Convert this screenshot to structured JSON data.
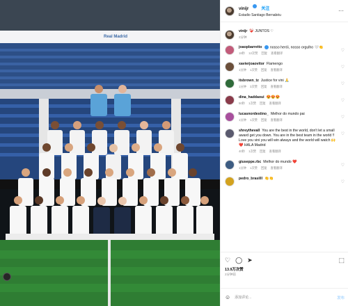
{
  "post": {
    "username": "vinijr",
    "follow_label": "关注",
    "location": "Estadio Santiago Bernabéu",
    "caption_text": "❤️‍🩹 JUNTOS ♡",
    "caption_time": "2分钟",
    "likes": "13.9万次赞",
    "posted_ago": "2分钟前",
    "add_comment_placeholder": "添加评论...",
    "post_label": "发布",
    "banner_text": "Real Madrid"
  },
  "comments": [
    {
      "user": "joaopbarretto",
      "verified": true,
      "text": "nosso herói, nosso orgulho 🤍👏",
      "time": "18秒",
      "likes": "12次赞",
      "reply": "回复",
      "translate": "查看翻译",
      "avatar_color": "#c25b7a"
    },
    {
      "user": "xavierjoaovitor",
      "verified": false,
      "text": "Flamengo",
      "time": "1分钟",
      "likes": "1次赞",
      "reply": "回复",
      "translate": "查看翻译",
      "avatar_color": "#6b4f3a"
    },
    {
      "user": "itsbrown_tz",
      "verified": false,
      "text": "Justice for vini 🙏",
      "time": "1分钟",
      "likes": "3次赞",
      "reply": "回复",
      "translate": "查看翻译",
      "avatar_color": "#2f6b3a"
    },
    {
      "user": "dina_haddaoui",
      "verified": false,
      "text": "😍😍😍",
      "time": "50秒",
      "likes": "1次赞",
      "reply": "回复",
      "translate": "查看翻译",
      "avatar_color": "#8a3b4a"
    },
    {
      "user": "lucasnordestino_",
      "verified": false,
      "text": "Melhor do mundo pai",
      "time": "1分钟",
      "likes": "1次赞",
      "reply": "回复",
      "translate": "查看翻译",
      "avatar_color": "#a84f9d"
    },
    {
      "user": "shreythevall",
      "verified": false,
      "text": "You are the best in the world, don't let a small award get you down. You are in the best team in the world !! Love you vini you will win always and the world will watch 🙌 ❤️ HALA Madrid",
      "time": "40秒",
      "likes": "1次赞",
      "reply": "回复",
      "translate": "查看翻译",
      "avatar_color": "#5a5a6e"
    },
    {
      "user": "giuseppe.rbc",
      "verified": false,
      "text": "Melhor do mundo ❤️",
      "time": "1分钟",
      "likes": "1次赞",
      "reply": "回复",
      "translate": "查看翻译",
      "avatar_color": "#3d5c82"
    },
    {
      "user": "pedro_brasilll",
      "verified": false,
      "text": "👏👏",
      "time": "",
      "likes": "",
      "reply": "",
      "translate": "",
      "avatar_color": "#d3a21e"
    }
  ]
}
